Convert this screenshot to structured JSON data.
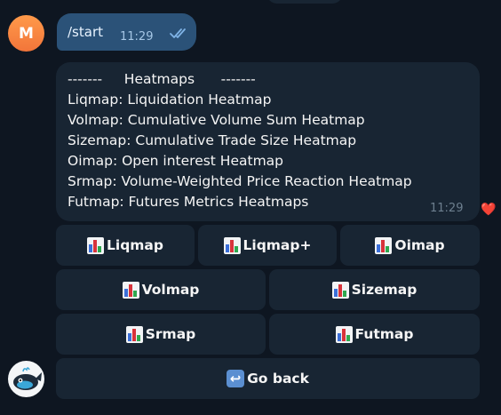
{
  "outgoing": {
    "text": "/start",
    "time": "11:29"
  },
  "user_avatar": {
    "letter": "M"
  },
  "incoming": {
    "lines": [
      "-------     Heatmaps      -------",
      "Liqmap: Liquidation Heatmap",
      "Volmap: Cumulative Volume Sum Heatmap",
      "Sizemap: Cumulative Trade Size Heatmap",
      "Oimap: Open interest Heatmap",
      "Srmap: Volume-Weighted Price Reaction Heatmap",
      "Futmap: Futures Metrics Heatmaps"
    ],
    "time": "11:29",
    "reaction": "❤️"
  },
  "keyboard": {
    "liqmap": "Liqmap",
    "liqmap_plus": "Liqmap+",
    "oimap": "Oimap",
    "volmap": "Volmap",
    "sizemap": "Sizemap",
    "srmap": "Srmap",
    "futmap": "Futmap",
    "go_back": "Go back"
  },
  "icons": {
    "button_icon": "bar-chart-icon",
    "back_icon": "return-arrow-icon",
    "read_receipt": "double-check-icon",
    "bot_avatar": "whale-icon"
  },
  "colors": {
    "background": "#0e1621",
    "incoming_bubble": "#182533",
    "outgoing_bubble": "#2b5278",
    "button": "#182533",
    "avatar_m": "#f2753a"
  }
}
